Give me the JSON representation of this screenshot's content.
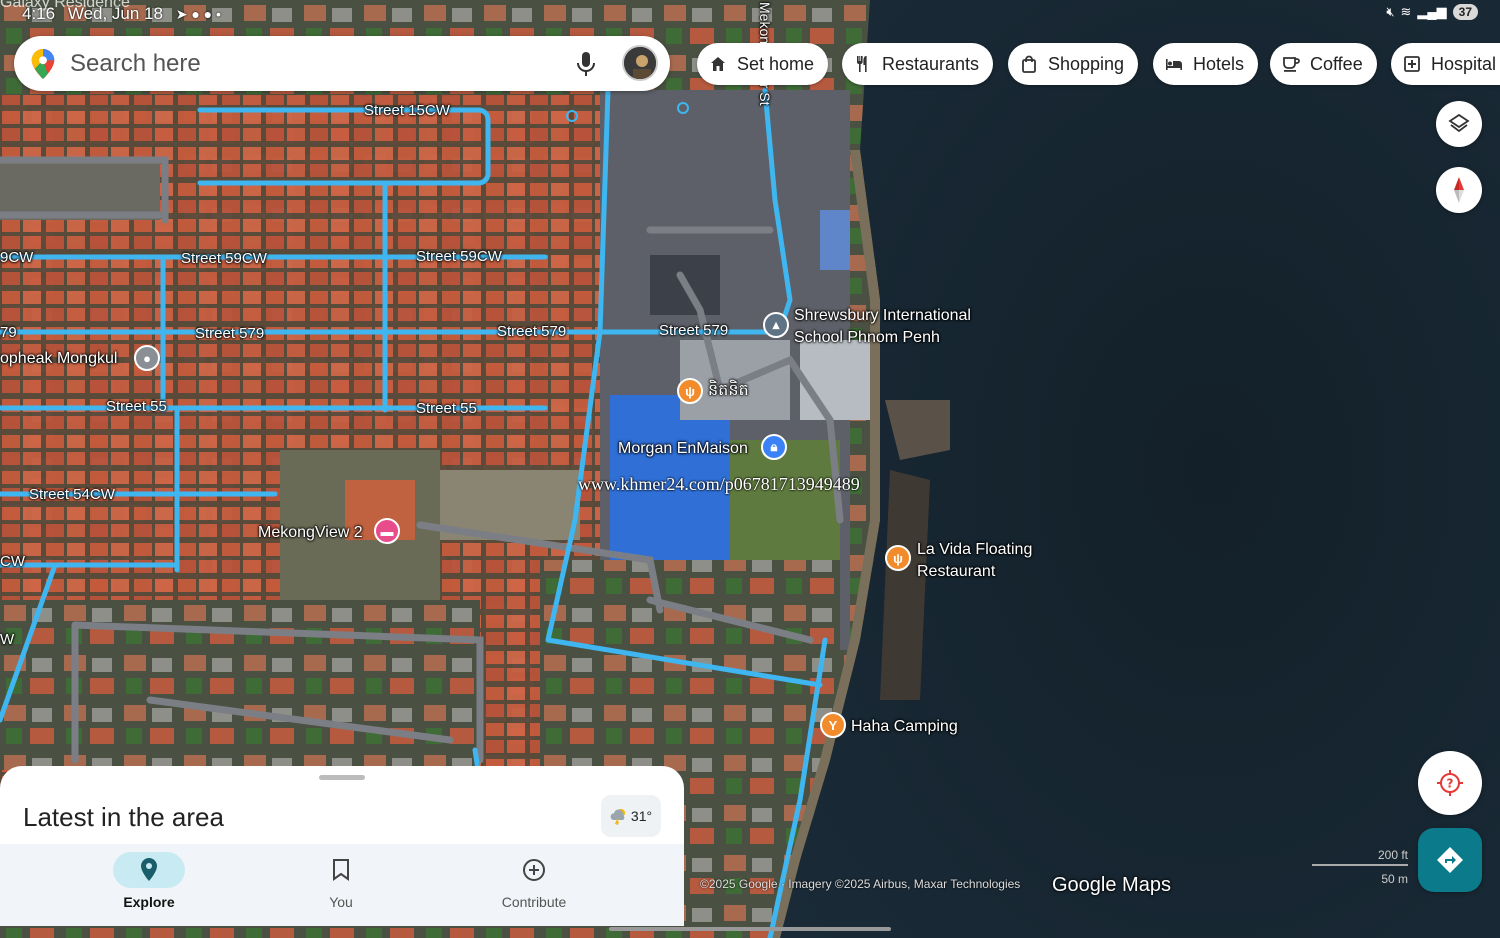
{
  "status_bar": {
    "time": "4:16",
    "date": "Wed, Jun 18",
    "overlay_text": "Galaxy Residence",
    "battery": "37"
  },
  "search": {
    "placeholder": "Search here"
  },
  "chips": [
    {
      "label": "Set home",
      "icon": "home-icon"
    },
    {
      "label": "Restaurants",
      "icon": "fork-knife-icon"
    },
    {
      "label": "Shopping",
      "icon": "shopping-bag-icon"
    },
    {
      "label": "Hotels",
      "icon": "bed-icon"
    },
    {
      "label": "Coffee",
      "icon": "coffee-cup-icon"
    },
    {
      "label": "Hospital",
      "icon": "hospital-icon"
    }
  ],
  "map": {
    "street_labels": [
      "Street 15CW",
      "Street 59CW",
      "Street 59CW",
      "Street 579",
      "Street 579",
      "Street 579",
      "Street 55",
      "Street 55",
      "Street 54CW",
      "9CW",
      "79",
      "CW",
      "W",
      "Mekong River St"
    ],
    "places": [
      {
        "name": "Shrewsbury International School Phnom Penh",
        "line1": "Shrewsbury International",
        "line2": "School Phnom Penh",
        "type": "school",
        "color": "#5f7385"
      },
      {
        "name": "នំបាំង",
        "line1": "និតនិត",
        "type": "restaurant",
        "color": "#f28b2c"
      },
      {
        "name": "Morgan EnMaison",
        "line1": "Morgan EnMaison",
        "type": "hotel-lock",
        "color": "#3b82f6"
      },
      {
        "name": "La Vida Floating Restaurant",
        "line1": "La Vida Floating",
        "line2": "Restaurant",
        "type": "restaurant",
        "color": "#f28b2c"
      },
      {
        "name": "MekongView 2",
        "line1": "MekongView 2",
        "type": "hotel",
        "color": "#e94c8b"
      },
      {
        "name": "Sopheak Mongkul",
        "line1": "opheak Mongkul",
        "type": "place",
        "color": "#8a8f96"
      },
      {
        "name": "Haha Camping",
        "line1": "Haha Camping",
        "type": "camping",
        "color": "#f28b2c"
      }
    ],
    "watermark": "www.khmer24.com/p06781713949489",
    "copyright": "©2025 Google · Imagery ©2025 Airbus, Maxar Technologies",
    "logo": "Google Maps",
    "scale_ft": "200 ft",
    "scale_m": "50 m"
  },
  "sheet": {
    "title": "Latest in the area",
    "weather": "31°"
  },
  "nav": [
    {
      "label": "Explore",
      "icon": "explore-pin-icon",
      "active": true
    },
    {
      "label": "You",
      "icon": "bookmark-icon",
      "active": false
    },
    {
      "label": "Contribute",
      "icon": "plus-circle-icon",
      "active": false
    }
  ],
  "colors": {
    "road": "#3fb6f0",
    "water": "#15222d",
    "roof": "#c85b3e",
    "direction_button": "#0b7a8a"
  }
}
